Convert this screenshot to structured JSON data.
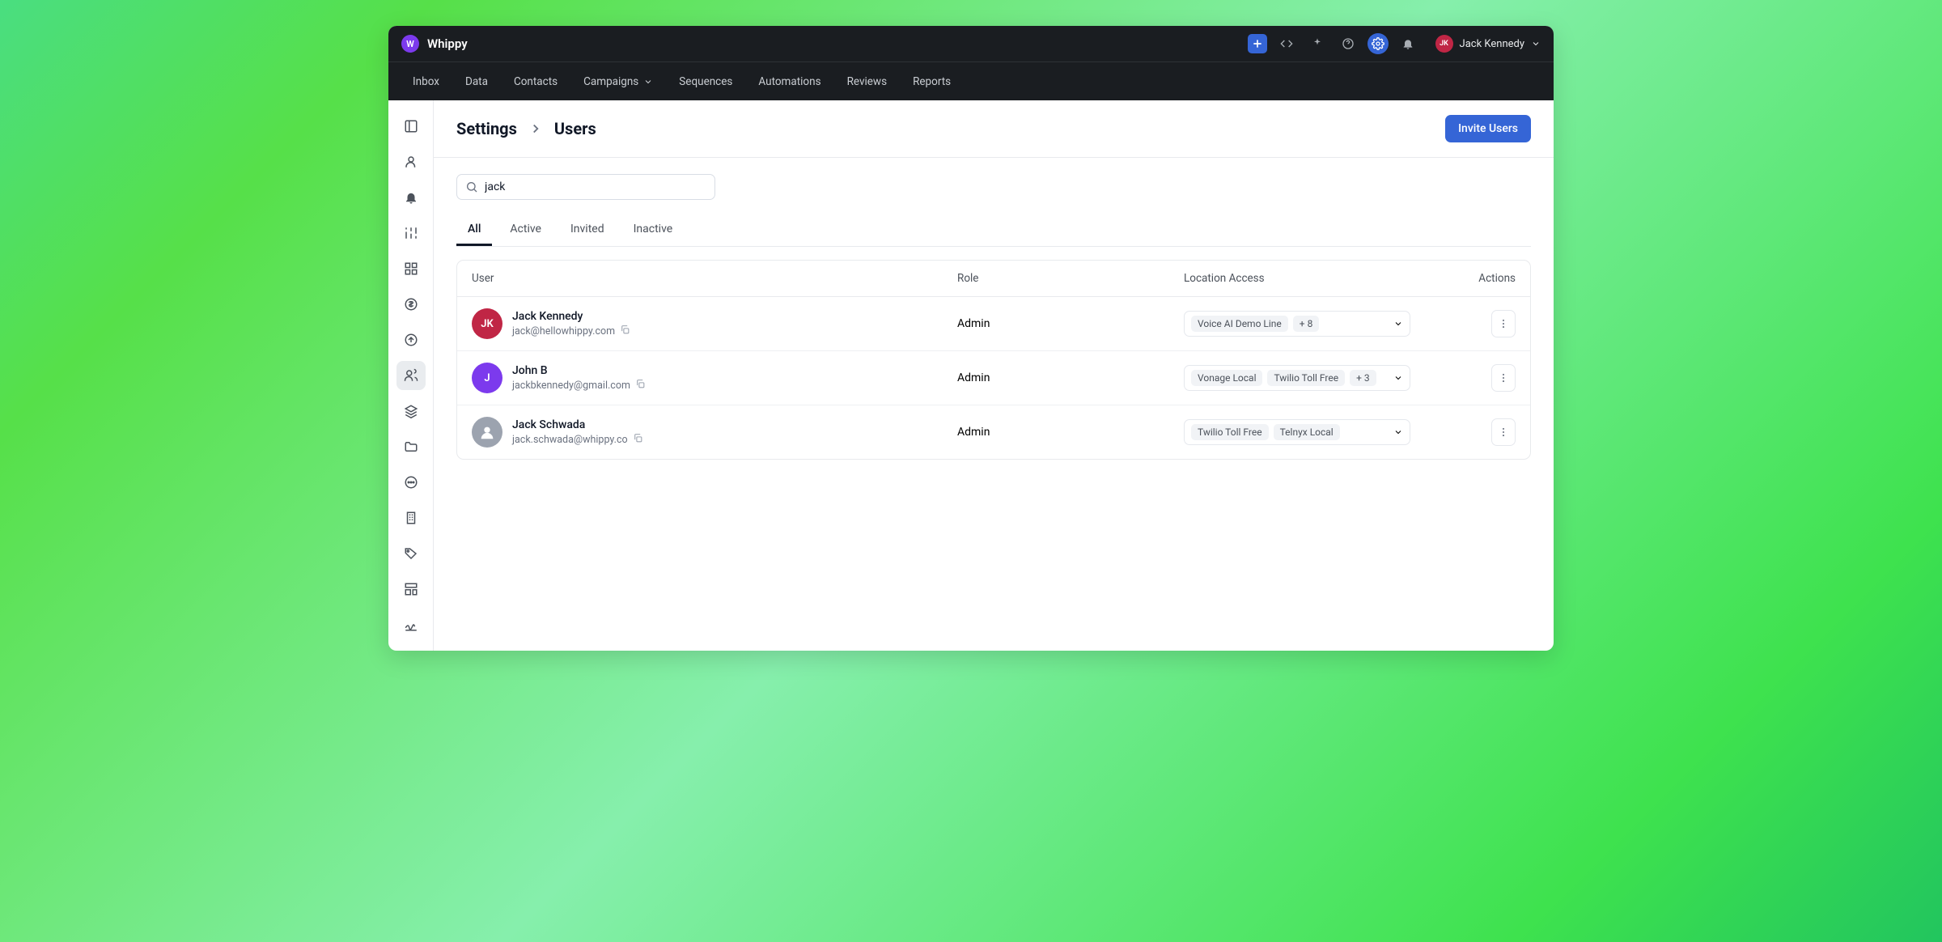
{
  "app": {
    "name": "Whippy",
    "logo_letter": "W"
  },
  "topbar_user": {
    "initials": "JK",
    "name": "Jack Kennedy"
  },
  "nav": {
    "items": [
      {
        "label": "Inbox"
      },
      {
        "label": "Data"
      },
      {
        "label": "Contacts"
      },
      {
        "label": "Campaigns",
        "dropdown": true
      },
      {
        "label": "Sequences"
      },
      {
        "label": "Automations"
      },
      {
        "label": "Reviews"
      },
      {
        "label": "Reports"
      }
    ]
  },
  "breadcrumb": {
    "root": "Settings",
    "page": "Users"
  },
  "actions": {
    "invite_label": "Invite Users"
  },
  "search": {
    "value": "jack"
  },
  "tabs": [
    {
      "label": "All",
      "active": true
    },
    {
      "label": "Active"
    },
    {
      "label": "Invited"
    },
    {
      "label": "Inactive"
    }
  ],
  "table": {
    "headers": {
      "user": "User",
      "role": "Role",
      "location": "Location Access",
      "actions": "Actions"
    },
    "rows": [
      {
        "avatar_text": "JK",
        "avatar_class": "initials",
        "name": "Jack Kennedy",
        "email": "jack@hellowhippy.com",
        "role": "Admin",
        "locations": [
          "Voice AI Demo Line"
        ],
        "extra": "+ 8"
      },
      {
        "avatar_text": "J",
        "avatar_class": "letter",
        "name": "John B",
        "email": "jackbkennedy@gmail.com",
        "role": "Admin",
        "locations": [
          "Vonage Local",
          "Twilio Toll Free"
        ],
        "extra": "+ 3"
      },
      {
        "avatar_text": "",
        "avatar_class": "img",
        "name": "Jack Schwada",
        "email": "jack.schwada@whippy.co",
        "role": "Admin",
        "locations": [
          "Twilio Toll Free",
          "Telnyx Local"
        ],
        "extra": ""
      }
    ]
  }
}
